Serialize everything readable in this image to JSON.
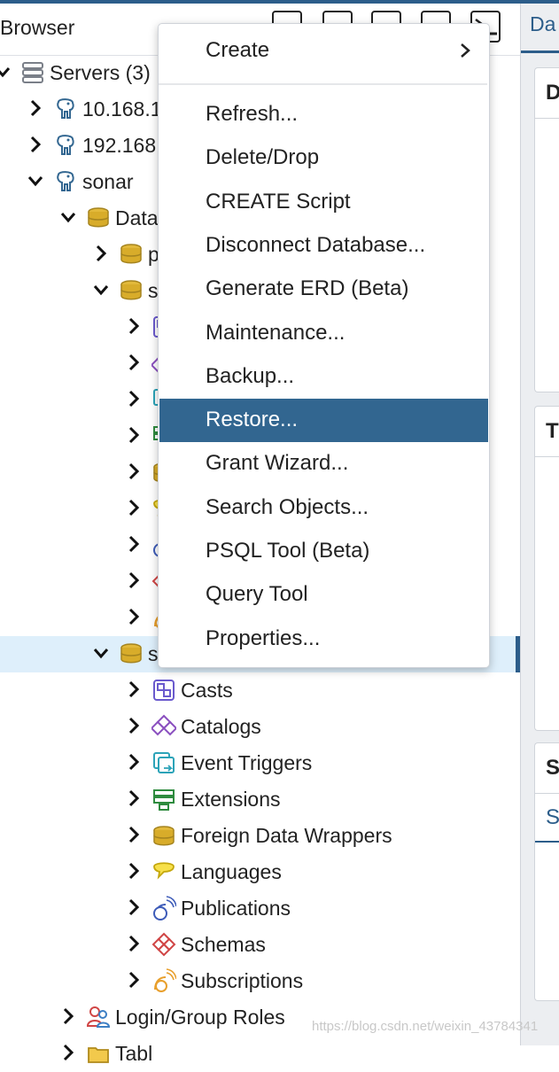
{
  "app": {
    "panel_title": "Browser",
    "right_tab_label": "Da",
    "right_cards": [
      "D",
      "T",
      "S"
    ],
    "right_subtab": "S"
  },
  "tree": [
    {
      "label": "Servers (3)",
      "icon": "servers-icon",
      "toggle": "expanded"
    },
    {
      "label": "10.168.1",
      "icon": "postgres-elephant-icon",
      "toggle": "collapsed"
    },
    {
      "label": "192.168",
      "icon": "postgres-elephant-icon",
      "toggle": "collapsed"
    },
    {
      "label": "sonar",
      "icon": "postgres-elephant-icon",
      "toggle": "expanded"
    },
    {
      "label": "Data",
      "icon": "databases-icon",
      "toggle": "expanded"
    },
    {
      "label": "p",
      "icon": "database-icon",
      "toggle": "collapsed"
    },
    {
      "label": "s",
      "icon": "database-icon",
      "toggle": "expanded"
    },
    {
      "label": "",
      "icon": "casts-icon",
      "toggle": "collapsed"
    },
    {
      "label": "",
      "icon": "catalogs-icon",
      "toggle": "collapsed"
    },
    {
      "label": "",
      "icon": "event-triggers-icon",
      "toggle": "collapsed"
    },
    {
      "label": "",
      "icon": "extensions-icon",
      "toggle": "collapsed"
    },
    {
      "label": "",
      "icon": "foreign-data-wrappers-icon",
      "toggle": "collapsed"
    },
    {
      "label": "",
      "icon": "languages-icon",
      "toggle": "collapsed"
    },
    {
      "label": "",
      "icon": "publications-icon",
      "toggle": "collapsed"
    },
    {
      "label": "",
      "icon": "schemas-icon",
      "toggle": "collapsed"
    },
    {
      "label": "",
      "icon": "subscriptions-icon",
      "toggle": "collapsed"
    },
    {
      "label": "s",
      "icon": "database-icon",
      "toggle": "expanded",
      "selected": true
    },
    {
      "label": "Casts",
      "icon": "casts-icon",
      "toggle": "collapsed"
    },
    {
      "label": "Catalogs",
      "icon": "catalogs-icon",
      "toggle": "collapsed"
    },
    {
      "label": "Event Triggers",
      "icon": "event-triggers-icon",
      "toggle": "collapsed"
    },
    {
      "label": "Extensions",
      "icon": "extensions-icon",
      "toggle": "collapsed"
    },
    {
      "label": "Foreign Data Wrappers",
      "icon": "foreign-data-wrappers-icon",
      "toggle": "collapsed"
    },
    {
      "label": "Languages",
      "icon": "languages-icon",
      "toggle": "collapsed"
    },
    {
      "label": "Publications",
      "icon": "publications-icon",
      "toggle": "collapsed"
    },
    {
      "label": "Schemas",
      "icon": "schemas-icon",
      "toggle": "collapsed"
    },
    {
      "label": "Subscriptions",
      "icon": "subscriptions-icon",
      "toggle": "collapsed"
    },
    {
      "label": "Login/Group Roles",
      "icon": "login-roles-icon",
      "toggle": "collapsed"
    },
    {
      "label": "Tabl",
      "icon": "tablespaces-icon",
      "toggle": "collapsed"
    }
  ],
  "context_menu": {
    "items": [
      {
        "label": "Create",
        "submenu": true
      },
      {
        "label": "Refresh..."
      },
      {
        "label": "Delete/Drop"
      },
      {
        "label": "CREATE Script"
      },
      {
        "label": "Disconnect Database..."
      },
      {
        "label": "Generate ERD (Beta)"
      },
      {
        "label": "Maintenance..."
      },
      {
        "label": "Backup..."
      },
      {
        "label": "Restore...",
        "active": true
      },
      {
        "label": "Grant Wizard..."
      },
      {
        "label": "Search Objects..."
      },
      {
        "label": "PSQL Tool (Beta)"
      },
      {
        "label": "Query Tool"
      },
      {
        "label": "Properties..."
      }
    ]
  },
  "watermark": "https://blog.csdn.net/weixin_43784341",
  "colors": {
    "accent": "#2c5d8a",
    "menu_active": "#326690",
    "selected_row": "#deeffb"
  }
}
